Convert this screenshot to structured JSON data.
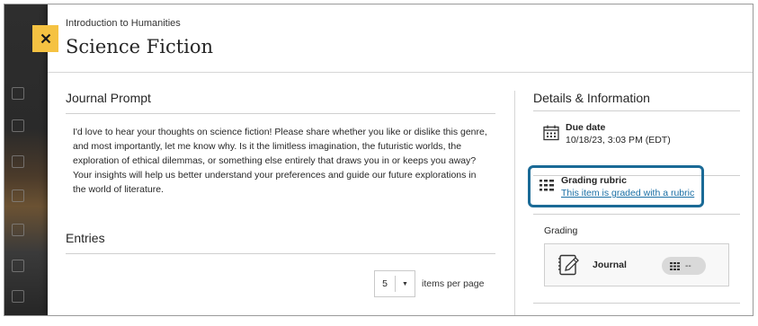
{
  "header": {
    "course_name": "Introduction to Humanities",
    "title": "Science Fiction",
    "close_icon": "close-icon"
  },
  "journal_prompt": {
    "heading": "Journal Prompt",
    "text": "I'd love to hear your thoughts on science fiction! Please share whether you like or dislike this genre, and most importantly, let me know why. Is it the limitless imagination, the futuristic worlds, the exploration of ethical dilemmas, or something else entirely that draws you in or keeps you away? Your insights will help us better understand your preferences and guide our future explorations in the world of literature."
  },
  "entries": {
    "heading": "Entries",
    "page_size": "5",
    "per_page_label": "items per page"
  },
  "details": {
    "heading": "Details & Information",
    "due_date": {
      "icon": "calendar-icon",
      "label": "Due date",
      "value": "10/18/23, 3:03 PM (EDT)"
    },
    "rubric": {
      "icon": "rubric-icon",
      "label": "Grading rubric",
      "link": "This item is graded with a rubric"
    },
    "grading": {
      "label": "Grading",
      "item_icon": "journal-icon",
      "item_label": "Journal",
      "grade_icon": "gradebook-icon",
      "grade_value": "--"
    }
  },
  "colors": {
    "close_button": "#f5c242",
    "focus_ring": "#1a6a96",
    "link": "#1a6fa5"
  }
}
